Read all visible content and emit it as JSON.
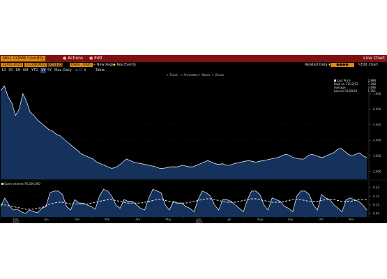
{
  "titlebar": {
    "ticker": "NG1 COMB Comdty",
    "actions": "Actions",
    "edit": "Edit",
    "title": "Line Chart"
  },
  "toolbar": {
    "range_start": "12/01/2021",
    "range_end": "11/29/2022",
    "last_price": "Last Px",
    "frequency": "Daily",
    "currency": "USD",
    "new_avgs": "New Avgs",
    "key_events": "Key Events",
    "related_data": "Related Data",
    "edit_chart": "Edit Chart"
  },
  "periods": [
    "1D",
    "3D",
    "1M",
    "6M",
    "YTD",
    "1Y",
    "5Y",
    "Max",
    "Daily"
  ],
  "selected_period": "1Y",
  "table_label": "Table",
  "tools": [
    "Track",
    "Annotate",
    "News",
    "Zoom"
  ],
  "main_legend": {
    "last_price": "Last Price",
    "high": "High on 11/22/22",
    "average": "Average",
    "low": "Low on 01/28/22",
    "values": [
      "2.898",
      "7.308",
      "3.496",
      "1.951"
    ]
  },
  "lower_legend": "Open Interest  76,000,000",
  "x_axis": {
    "months": [
      "Dec",
      "Jan",
      "Feb",
      "Mar",
      "Apr",
      "May",
      "Jun",
      "Jul",
      "Aug",
      "Sep",
      "Oct",
      "Nov"
    ],
    "years": [
      "2022",
      "2022"
    ]
  },
  "colors": {
    "area": "#14325c",
    "line": "#dfe8f5",
    "accent": "#d98a10",
    "titlebar": "#7e0f12"
  },
  "chart_data": [
    {
      "type": "area",
      "title": "",
      "series": [
        {
          "name": "Last Price",
          "values": [
            7.2,
            7.5,
            6.8,
            6.4,
            5.6,
            6.0,
            7.0,
            6.5,
            5.8,
            5.6,
            5.3,
            5.1,
            4.9,
            4.7,
            4.6,
            4.4,
            4.3,
            4.1,
            3.9,
            3.7,
            3.5,
            3.3,
            3.1,
            3.0,
            2.9,
            2.8,
            2.6,
            2.5,
            2.4,
            2.3,
            2.2,
            2.25,
            2.4,
            2.6,
            2.8,
            2.7,
            2.6,
            2.55,
            2.5,
            2.45,
            2.4,
            2.35,
            2.3,
            2.2,
            2.2,
            2.25,
            2.3,
            2.3,
            2.3,
            2.4,
            2.35,
            2.3,
            2.3,
            2.4,
            2.5,
            2.6,
            2.7,
            2.6,
            2.5,
            2.45,
            2.5,
            2.4,
            2.4,
            2.5,
            2.55,
            2.6,
            2.65,
            2.7,
            2.65,
            2.6,
            2.65,
            2.7,
            2.75,
            2.8,
            2.85,
            2.9,
            3.0,
            3.1,
            3.05,
            2.9,
            2.85,
            2.8,
            2.8,
            3.0,
            3.1,
            3.05,
            2.95,
            2.9,
            3.0,
            3.1,
            3.2,
            3.4,
            3.5,
            3.3,
            3.1,
            3.0,
            3.1,
            3.2,
            3.0,
            2.9
          ]
        }
      ],
      "ylim": [
        1.5,
        8.0
      ],
      "yticks": [
        "2.000",
        "3.000",
        "4.000",
        "5.000",
        "6.000",
        "7.000"
      ]
    },
    {
      "type": "area",
      "title": "",
      "series": [
        {
          "name": "Open Interest",
          "values": [
            0.12,
            0.22,
            0.14,
            0.08,
            0.09,
            0.06,
            0.04,
            0.08,
            0.06,
            0.05,
            0.1,
            0.12,
            0.28,
            0.3,
            0.3,
            0.26,
            0.12,
            0.08,
            0.2,
            0.16,
            0.16,
            0.14,
            0.12,
            0.09,
            0.24,
            0.32,
            0.3,
            0.24,
            0.14,
            0.1,
            0.2,
            0.18,
            0.18,
            0.14,
            0.1,
            0.08,
            0.22,
            0.32,
            0.3,
            0.28,
            0.14,
            0.08,
            0.18,
            0.16,
            0.16,
            0.12,
            0.1,
            0.06,
            0.2,
            0.3,
            0.28,
            0.24,
            0.14,
            0.08,
            0.2,
            0.2,
            0.18,
            0.14,
            0.1,
            0.06,
            0.2,
            0.3,
            0.3,
            0.26,
            0.14,
            0.08,
            0.22,
            0.2,
            0.18,
            0.12,
            0.1,
            0.06,
            0.24,
            0.3,
            0.3,
            0.26,
            0.14,
            0.08,
            0.26,
            0.22,
            0.2,
            0.14,
            0.1,
            0.06,
            0.2,
            0.22,
            0.2,
            0.18,
            0.14,
            0.08
          ]
        },
        {
          "name": "Moving Average",
          "values": [
            0.14,
            0.14,
            0.13,
            0.12,
            0.11,
            0.1,
            0.09,
            0.09,
            0.09,
            0.1,
            0.11,
            0.13,
            0.15,
            0.16,
            0.17,
            0.17,
            0.16,
            0.15,
            0.15,
            0.15,
            0.15,
            0.15,
            0.16,
            0.17,
            0.18,
            0.19,
            0.2,
            0.2,
            0.19,
            0.18,
            0.17,
            0.16,
            0.16,
            0.16,
            0.16,
            0.17,
            0.18,
            0.19,
            0.2,
            0.2,
            0.19,
            0.18,
            0.17,
            0.16,
            0.16,
            0.16,
            0.17,
            0.18,
            0.19,
            0.2,
            0.21,
            0.21,
            0.2,
            0.19,
            0.18,
            0.17,
            0.17,
            0.17,
            0.18,
            0.19,
            0.2,
            0.21,
            0.21,
            0.2,
            0.19,
            0.18,
            0.17,
            0.17,
            0.17,
            0.18,
            0.19,
            0.2,
            0.2,
            0.2,
            0.19,
            0.18,
            0.18,
            0.18,
            0.19,
            0.2,
            0.2,
            0.2,
            0.19,
            0.18,
            0.18,
            0.18,
            0.19,
            0.2,
            0.2,
            0.2
          ]
        }
      ],
      "ylim": [
        0.0,
        0.42
      ],
      "yticks": [
        "0.04",
        "0.14",
        "0.24",
        "0.34"
      ]
    }
  ]
}
